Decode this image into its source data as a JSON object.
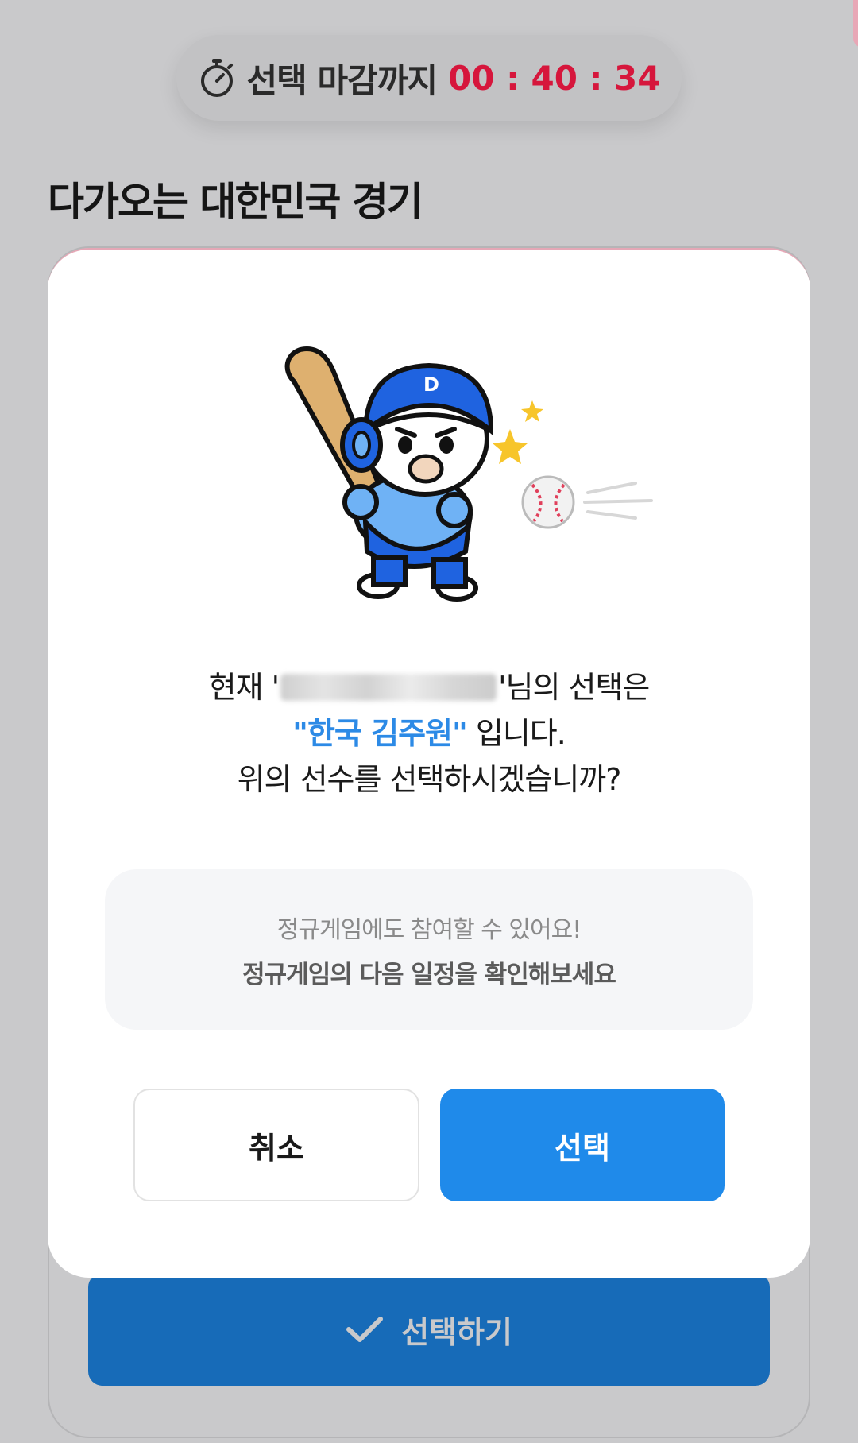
{
  "timer": {
    "label": "선택 마감까지",
    "value": "00 : 40 : 34"
  },
  "section": {
    "title": "다가오는 대한민국 경기"
  },
  "background_button": {
    "label": "선택하기"
  },
  "modal": {
    "line1_prefix": "현재 '",
    "line1_suffix": "'님의 선택은",
    "player": "\"한국 김주원\"",
    "line2_suffix": " 입니다.",
    "line3": "위의 선수를 선택하시겠습니까?",
    "info_line1": "정규게임에도 참여할 수 있어요!",
    "info_line2": "정규게임의 다음 일정을 확인해보세요",
    "cancel_label": "취소",
    "select_label": "선택",
    "mascot_cap_letter": "D"
  },
  "colors": {
    "timer_red": "#d6163c",
    "primary_blue": "#1f8aea",
    "player_blue": "#2c8ae6",
    "dim_overlay": "#c9c9cb"
  }
}
